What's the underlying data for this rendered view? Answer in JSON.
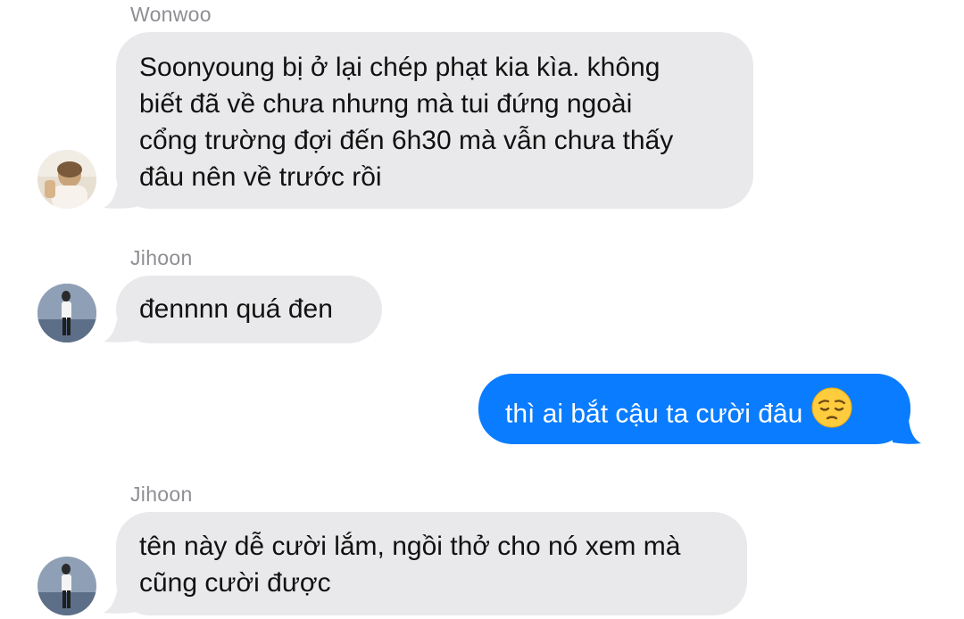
{
  "conversation": {
    "messages": [
      {
        "sender": "Wonwoo",
        "direction": "incoming",
        "lines": [
          "Soonyoung bị ở lại chép phạt kia kìa. không",
          "biết đã về chưa nhưng mà tui đứng ngoài",
          "cổng trường đợi đến 6h30 mà vẫn chưa thấy",
          "đâu nên về trước rồi"
        ]
      },
      {
        "sender": "Jihoon",
        "direction": "incoming",
        "lines": [
          "đennnn quá đen"
        ]
      },
      {
        "sender": "",
        "direction": "outgoing",
        "lines": [
          "thì ai bắt cậu ta cười đâu"
        ],
        "emoji": "pensive-face-emoji"
      },
      {
        "sender": "Jihoon",
        "direction": "incoming",
        "lines": [
          "tên này dễ cười lắm, ngồi thở cho nó xem mà",
          "cũng cười được"
        ]
      }
    ]
  },
  "colors": {
    "incoming_bubble": "#e9e9eb",
    "outgoing_bubble": "#0a7cff",
    "sender_name": "#8e8e93"
  }
}
